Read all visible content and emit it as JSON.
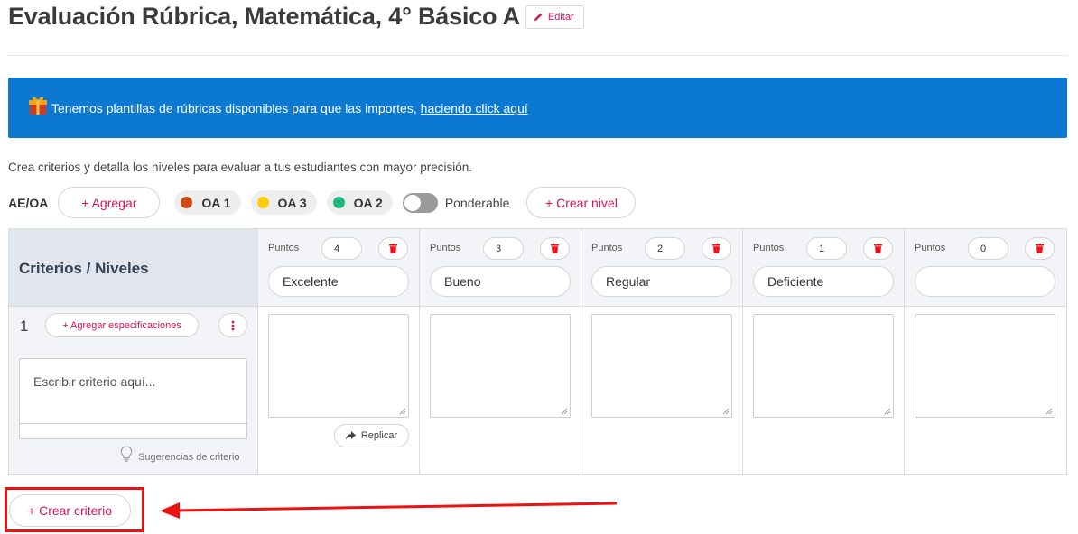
{
  "header": {
    "title": "Evaluación Rúbrica, Matemática, 4° Básico A",
    "edit_label": "Editar"
  },
  "banner": {
    "text": "Tenemos plantillas de rúbricas disponibles para que las importes,",
    "link_text": "haciendo click aquí",
    "icon": "gift-icon",
    "bg_color": "#0b78d1"
  },
  "intro_text": "Crea criterios y detalla los niveles para evaluar a tus estudiantes con mayor precisión.",
  "objectives": {
    "label": "AE/OA",
    "add_label": "+ Agregar",
    "chips": [
      {
        "label": "OA 1",
        "color": "#cc4b12"
      },
      {
        "label": "OA 3",
        "color": "#f7cf0f"
      },
      {
        "label": "OA 2",
        "color": "#1db87c"
      }
    ],
    "toggle_label": "Ponderable",
    "toggle_on": false,
    "create_level_label": "+ Crear nivel"
  },
  "rubric": {
    "header_label": "Criterios / Niveles",
    "points_label": "Puntos",
    "levels": [
      {
        "points": "4",
        "name": "Excelente"
      },
      {
        "points": "3",
        "name": "Bueno"
      },
      {
        "points": "2",
        "name": "Regular"
      },
      {
        "points": "1",
        "name": "Deficiente"
      },
      {
        "points": "0",
        "name": ""
      }
    ],
    "criteria": [
      {
        "number": "1",
        "add_spec_label": "+ Agregar especificaciones",
        "placeholder": "Escribir criterio aquí...",
        "suggestions_label": "Sugerencias de criterio",
        "replicate_label": "Replicar"
      }
    ]
  },
  "create_criterion_label": "+ Crear criterio",
  "accent_color": "#d6155b",
  "annotation_color": "#ee1111"
}
